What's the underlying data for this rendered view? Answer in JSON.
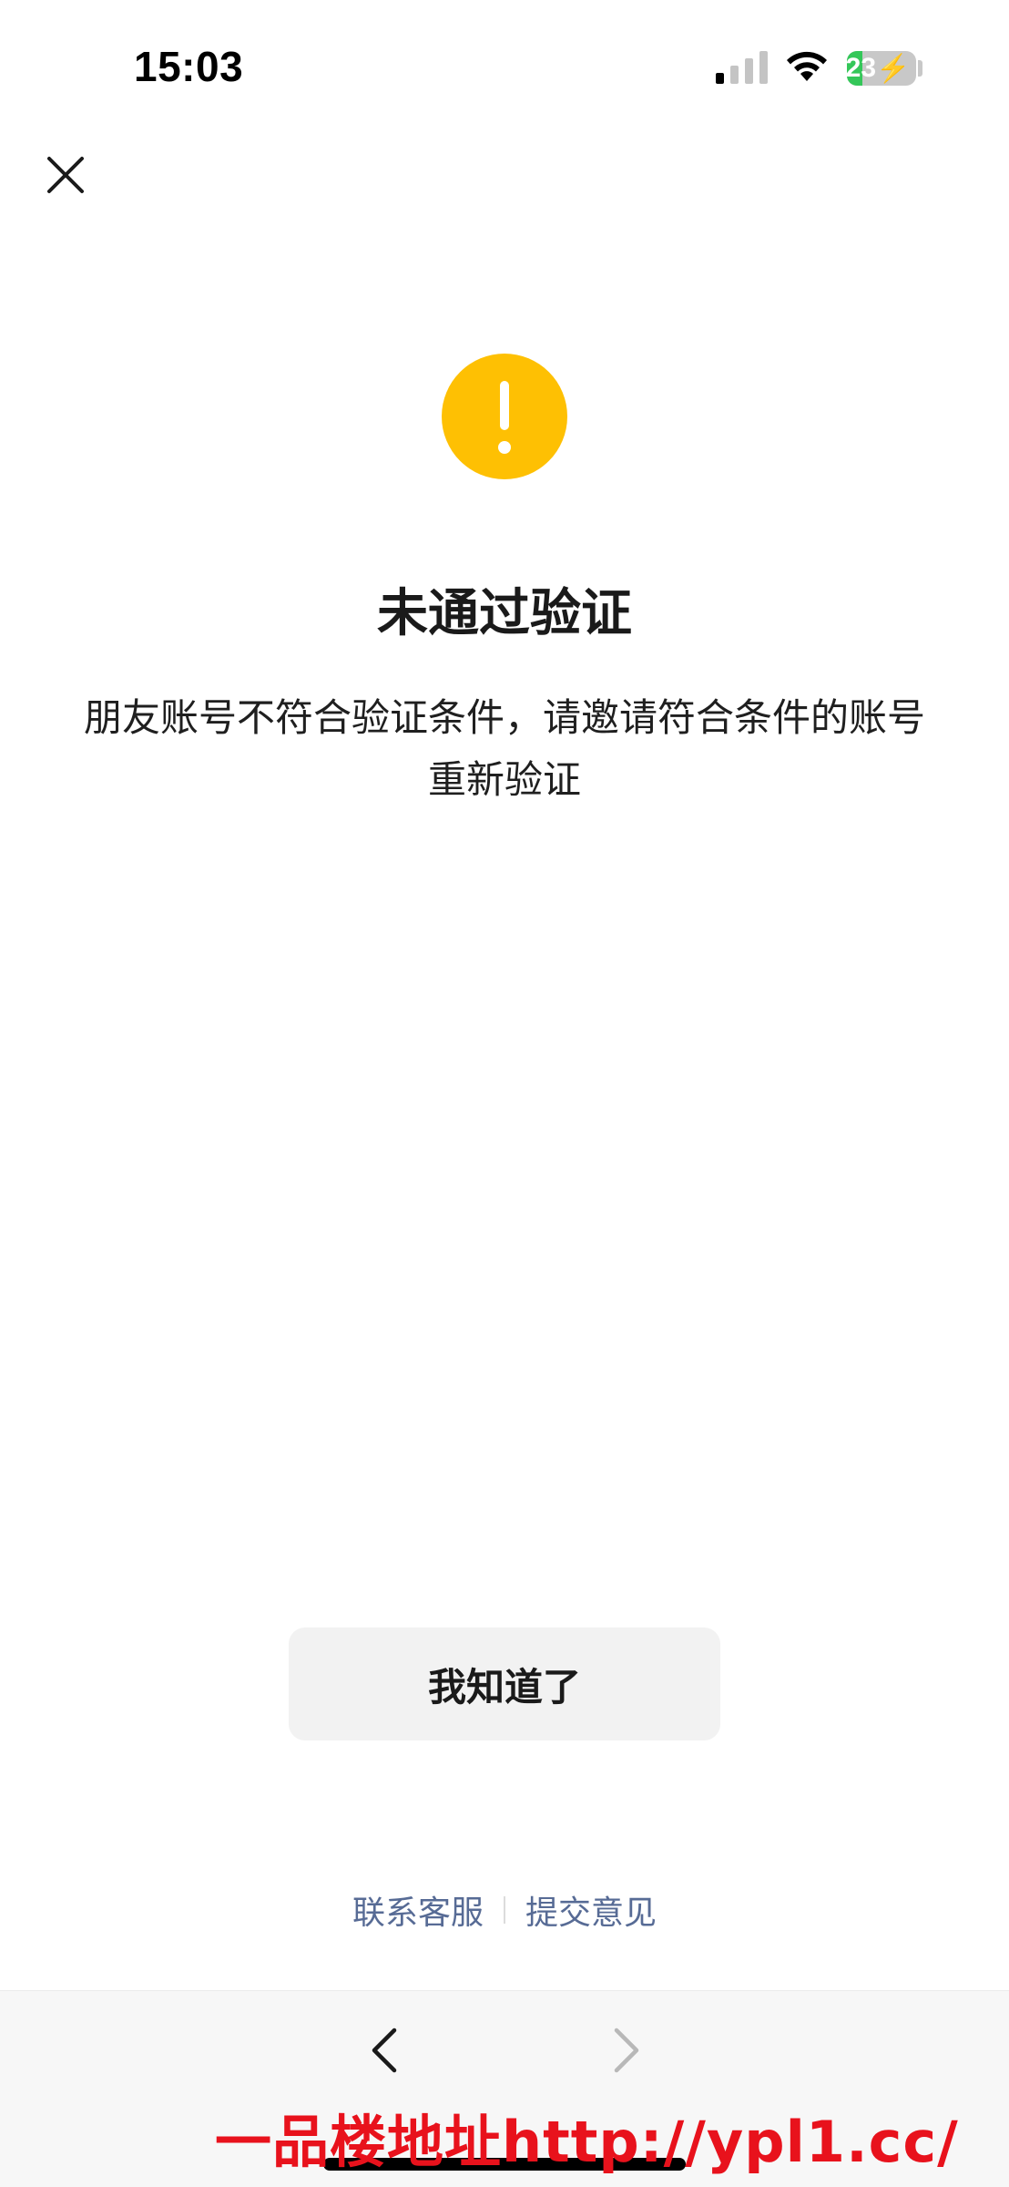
{
  "status_bar": {
    "time": "15:03",
    "battery_level": "23",
    "battery_fill_percent": 23,
    "battery_charging": true,
    "signal_bars_active": 1,
    "signal_bars_total": 4
  },
  "icons": {
    "close": "close-icon",
    "warning": "exclamation-icon",
    "back": "chevron-left-icon",
    "forward": "chevron-right-icon",
    "wifi": "wifi-icon",
    "signal": "signal-icon",
    "battery": "battery-icon"
  },
  "result": {
    "title": "未通过验证",
    "description": "朋友账号不符合验证条件，请邀请符合条件的账号重新验证"
  },
  "actions": {
    "confirm_label": "我知道了"
  },
  "footer_links": {
    "contact_support": "联系客服",
    "submit_feedback": "提交意见"
  },
  "watermark": "一品楼地址http://ypl1.cc/",
  "colors": {
    "warning": "#fec003",
    "link": "#576b95",
    "battery": "#34c759",
    "watermark": "#e8121c"
  }
}
